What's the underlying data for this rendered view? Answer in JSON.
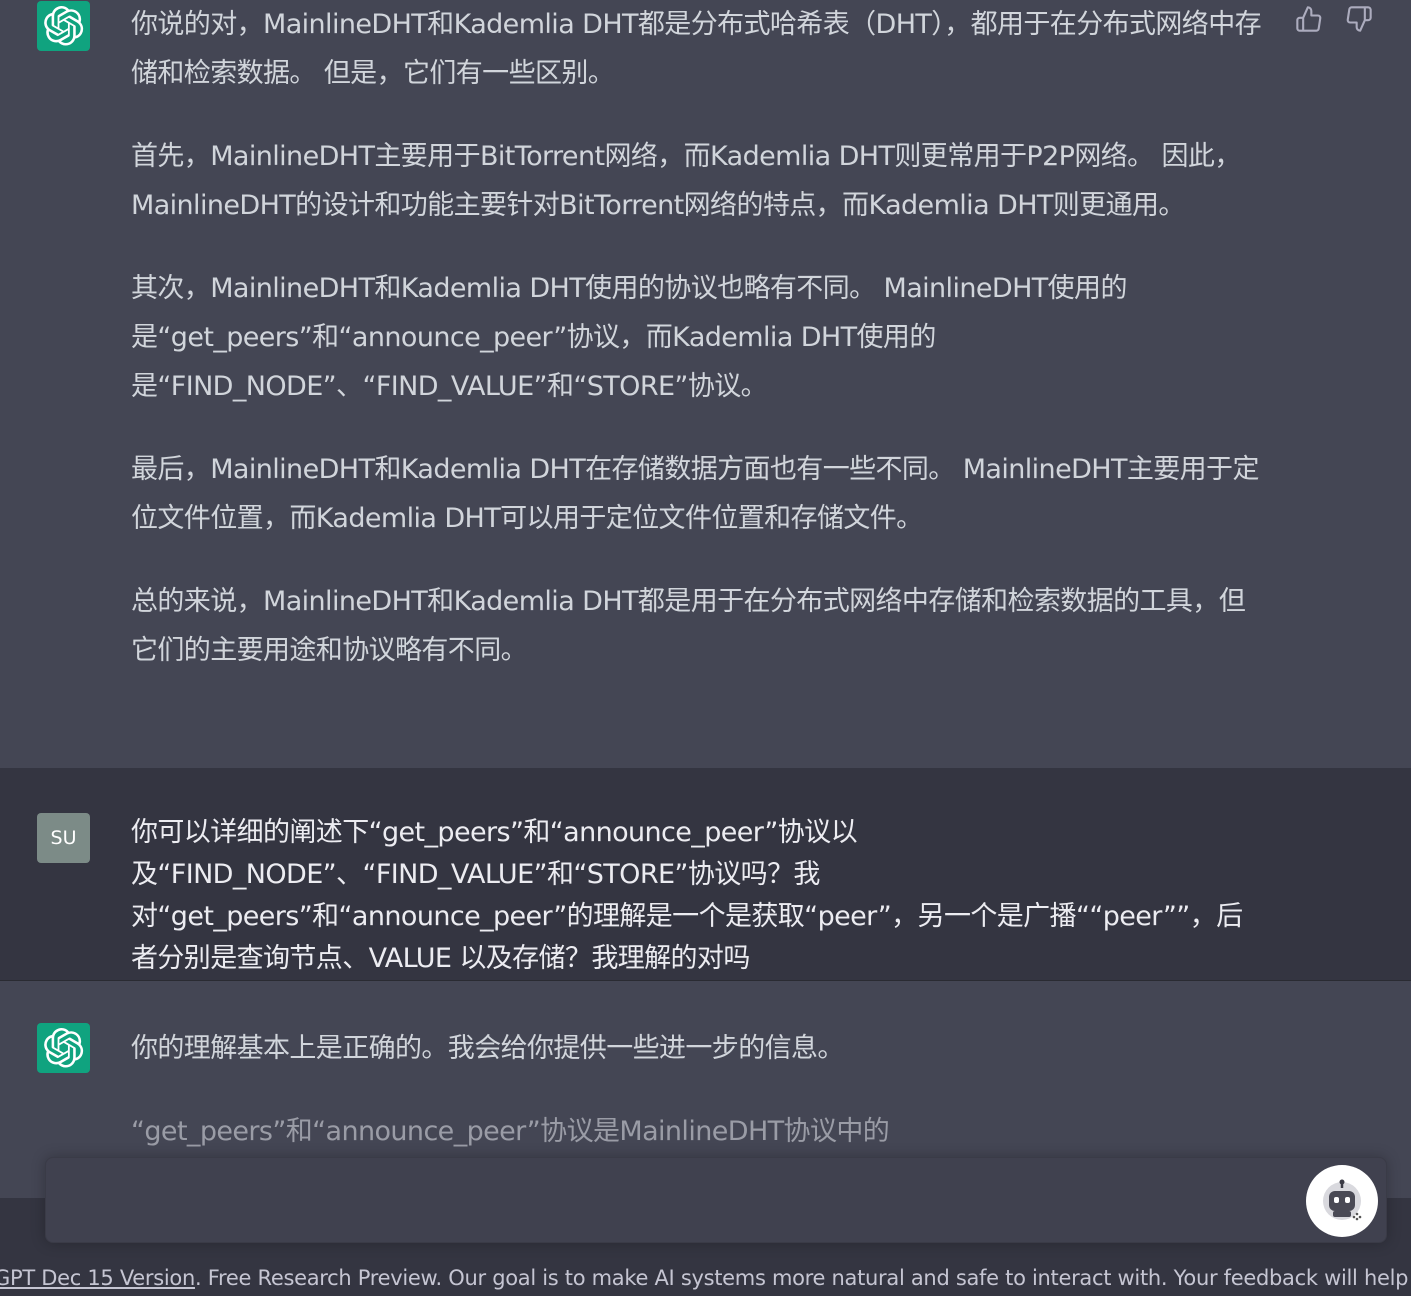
{
  "conversation": {
    "assistant_1": {
      "avatar_icon": "openai-logo-icon",
      "paragraphs": [
        "你说的对，MainlineDHT和Kademlia DHT都是分布式哈希表（DHT），都用于在分布式网络中存储和检索数据。 但是，它们有一些区别。",
        "首先，MainlineDHT主要用于BitTorrent网络，而Kademlia DHT则更常用于P2P网络。 因此，MainlineDHT的设计和功能主要针对BitTorrent网络的特点，而Kademlia DHT则更通用。",
        "其次，MainlineDHT和Kademlia DHT使用的协议也略有不同。 MainlineDHT使用的是“get_peers”和“announce_peer”协议，而Kademlia DHT使用的是“FIND_NODE”、“FIND_VALUE”和“STORE”协议。",
        "最后，MainlineDHT和Kademlia DHT在存储数据方面也有一些不同。 MainlineDHT主要用于定位文件位置，而Kademlia DHT可以用于定位文件位置和存储文件。",
        "总的来说，MainlineDHT和Kademlia DHT都是用于在分布式网络中存储和检索数据的工具，但它们的主要用途和协议略有不同。"
      ],
      "thumbs_up_icon": "thumbs-up-icon",
      "thumbs_down_icon": "thumbs-down-icon"
    },
    "user_1": {
      "avatar_text": "SU",
      "text": "你可以详细的阐述下“get_peers”和“announce_peer”协议以及“FIND_NODE”、“FIND_VALUE”和“STORE”协议吗？我对“get_peers”和“announce_peer”的理解是一个是获取“peer”，另一个是广播““peer””，后者分别是查询节点、VALUE 以及存储？我理解的对吗"
    },
    "assistant_2": {
      "avatar_icon": "openai-logo-icon",
      "paragraphs": [
        "你的理解基本上是正确的。我会给你提供一些进一步的信息。",
        "“get_peers”和“announce_peer”协议是MainlineDHT协议中的"
      ]
    }
  },
  "input": {
    "placeholder": "",
    "assistant_button_icon": "robot-icon"
  },
  "footer": {
    "link_text": "GPT Dec 15 Version",
    "text": ". Free Research Preview. Our goal is to make AI systems more natural and safe to interact with. Your feedback will help us improve."
  },
  "colors": {
    "background": "#343541",
    "assistant_background": "#444654",
    "accent": "#10a37f"
  }
}
